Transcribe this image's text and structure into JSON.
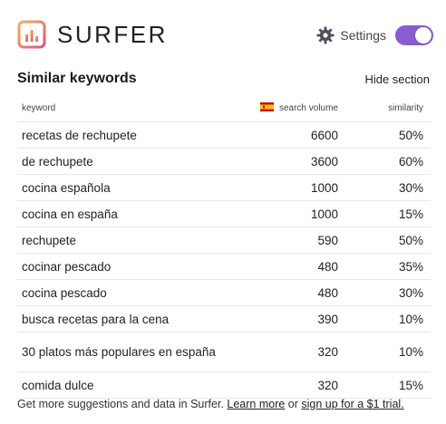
{
  "brand": {
    "name": "SURFER",
    "colors": {
      "logo_gradient_start": "#f7a45a",
      "logo_gradient_end": "#e0527b",
      "toggle": "#8a5cd1"
    }
  },
  "settings": {
    "label": "Settings",
    "icon": "gear-icon",
    "toggle_on": true
  },
  "section": {
    "title": "Similar keywords",
    "hide_label": "Hide section"
  },
  "table": {
    "headers": {
      "keyword": "keyword",
      "volume": "search volume",
      "similarity": "similarity",
      "flag": "spain-flag-icon"
    },
    "rows": [
      {
        "keyword": "recetas de rechupete",
        "volume": "6600",
        "similarity": "50%"
      },
      {
        "keyword": "de rechupete",
        "volume": "3600",
        "similarity": "60%"
      },
      {
        "keyword": "cocina española",
        "volume": "1000",
        "similarity": "30%"
      },
      {
        "keyword": "cocina en españa",
        "volume": "1000",
        "similarity": "15%"
      },
      {
        "keyword": "rechupete",
        "volume": "590",
        "similarity": "50%"
      },
      {
        "keyword": "cocinar pescado",
        "volume": "480",
        "similarity": "35%"
      },
      {
        "keyword": "cocina pescado",
        "volume": "480",
        "similarity": "30%"
      },
      {
        "keyword": "busca recetas para la cena",
        "volume": "390",
        "similarity": "10%"
      },
      {
        "keyword": "30 platos más populares en españa",
        "volume": "320",
        "similarity": "10%"
      },
      {
        "keyword": "comida dulce",
        "volume": "320",
        "similarity": "15%"
      }
    ]
  },
  "footer": {
    "text_before": "Get more suggestions and data in Surfer. ",
    "learn_more": "Learn more",
    "text_or": " or ",
    "signup": "sign up for a $1 trial."
  }
}
